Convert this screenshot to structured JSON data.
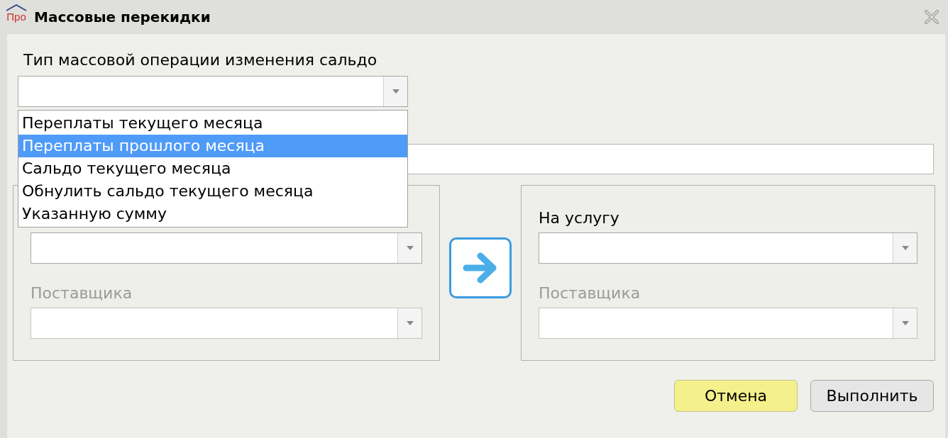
{
  "window": {
    "title": "Массовые перекидки",
    "logo_text": "Про"
  },
  "operation": {
    "label": "Тип массовой операции изменения сальдо",
    "expanded": true,
    "options": [
      {
        "label": "Переплаты текущего месяца",
        "selected": false
      },
      {
        "label": "Переплаты прошлого месяца",
        "selected": true
      },
      {
        "label": "Сальдо текущего месяца",
        "selected": false
      },
      {
        "label": "Обнулить сальдо текущего месяца",
        "selected": false
      },
      {
        "label": "Указанную сумму",
        "selected": false
      }
    ]
  },
  "from": {
    "fields": [
      {
        "disabled": false
      },
      {
        "label": "Поставщика",
        "disabled": true
      }
    ]
  },
  "to": {
    "fields": [
      {
        "label": "На услугу",
        "disabled": false
      },
      {
        "label": "Поставщика",
        "disabled": true
      }
    ]
  },
  "buttons": [
    {
      "label": "Отмена",
      "kind": "highlight"
    },
    {
      "label": "Выполнить",
      "kind": "normal"
    }
  ]
}
